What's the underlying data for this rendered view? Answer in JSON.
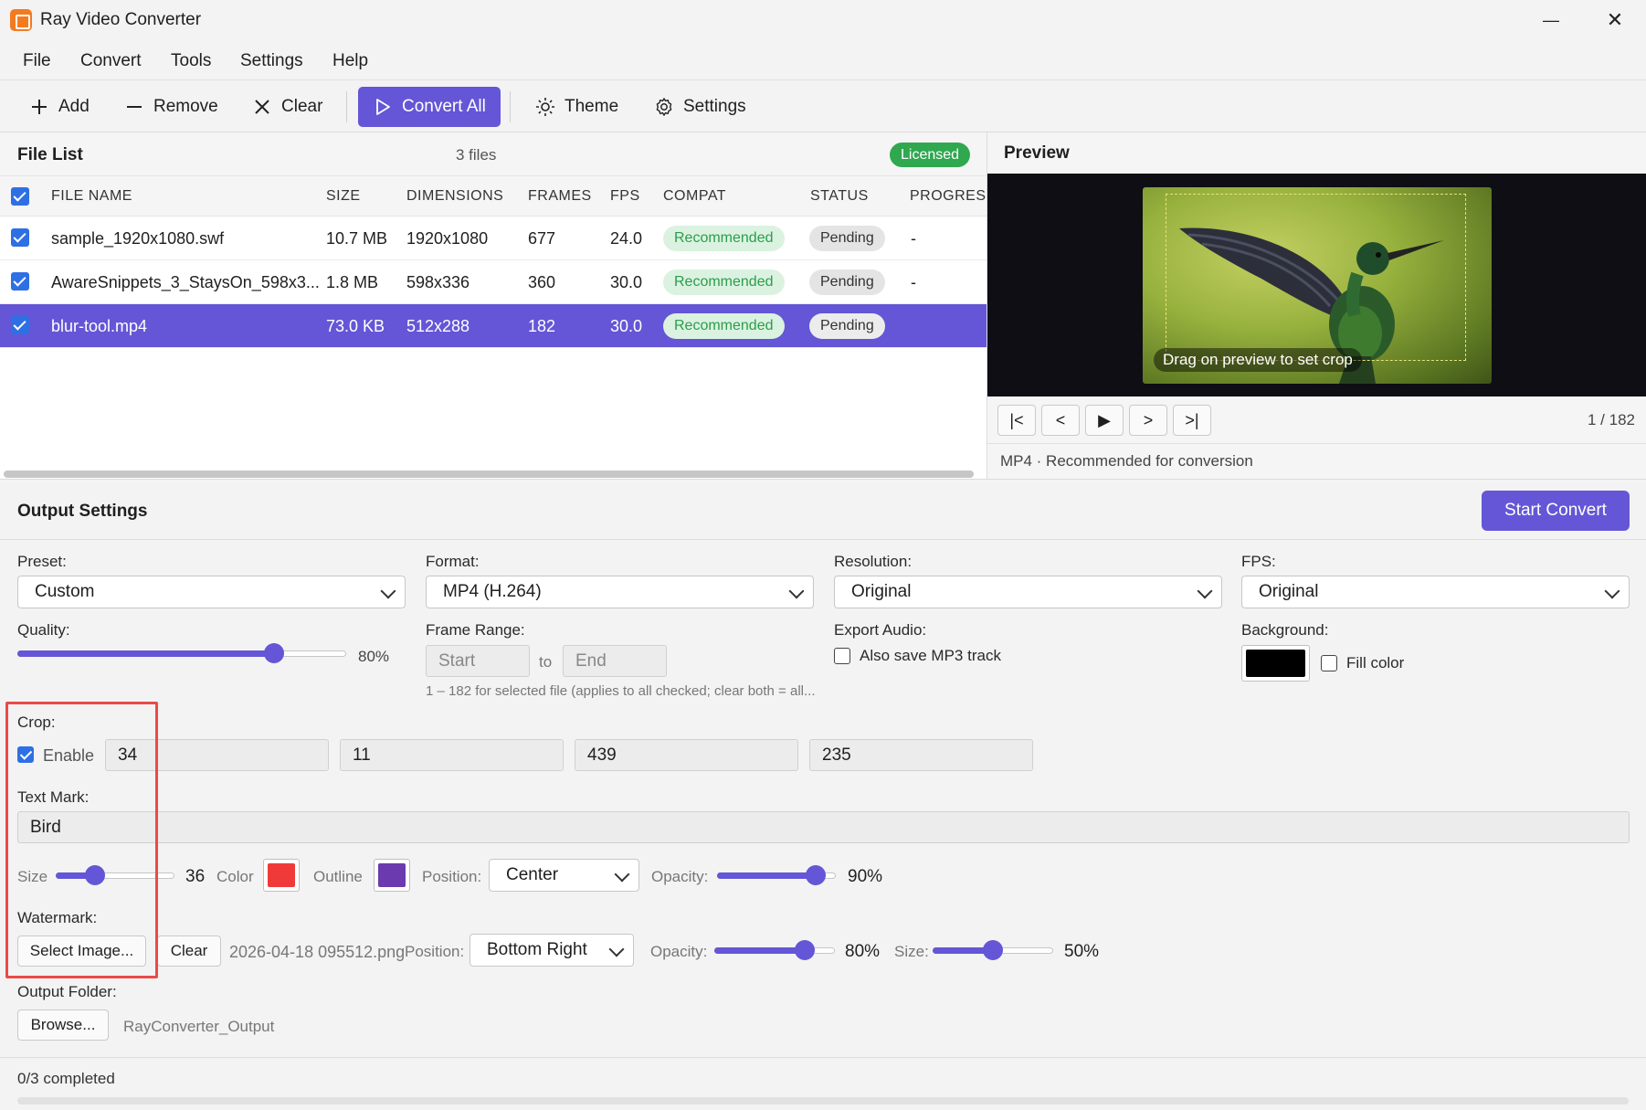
{
  "window": {
    "title": "Ray Video Converter",
    "minimize_glyph": "—",
    "maximize_glyph": "☐",
    "close_glyph": "✕"
  },
  "menu": [
    "File",
    "Convert",
    "Tools",
    "Settings",
    "Help"
  ],
  "toolbar": {
    "add": "Add",
    "remove": "Remove",
    "clear": "Clear",
    "convert_all": "Convert All",
    "theme": "Theme",
    "settings": "Settings"
  },
  "file_list": {
    "title": "File List",
    "count": "3 files",
    "license_badge": "Licensed",
    "columns": [
      "FILE NAME",
      "SIZE",
      "DIMENSIONS",
      "FRAMES",
      "FPS",
      "COMPAT",
      "STATUS",
      "PROGRESS"
    ],
    "rows": [
      {
        "name": "sample_1920x1080.swf",
        "size": "10.7 MB",
        "dimensions": "1920x1080",
        "frames": "677",
        "fps": "24.0",
        "compat": "Recommended",
        "status": "Pending",
        "progress": "-",
        "checked": true,
        "selected": false
      },
      {
        "name": "AwareSnippets_3_StaysOn_598x3...",
        "size": "1.8 MB",
        "dimensions": "598x336",
        "frames": "360",
        "fps": "30.0",
        "compat": "Recommended",
        "status": "Pending",
        "progress": "-",
        "checked": true,
        "selected": false
      },
      {
        "name": "blur-tool.mp4",
        "size": "73.0 KB",
        "dimensions": "512x288",
        "frames": "182",
        "fps": "30.0",
        "compat": "Recommended",
        "status": "Pending",
        "progress": "",
        "checked": true,
        "selected": true
      }
    ]
  },
  "preview": {
    "title": "Preview",
    "hint": "Drag on preview to set crop",
    "controls": [
      "|<",
      "<",
      "▶",
      ">",
      ">|"
    ],
    "frame_counter": "1 / 182",
    "info": "MP4 · Recommended for conversion"
  },
  "output": {
    "title": "Output Settings",
    "start_convert": "Start Convert",
    "preset": {
      "label": "Preset:",
      "value": "Custom"
    },
    "format": {
      "label": "Format:",
      "value": "MP4 (H.264)"
    },
    "resolution": {
      "label": "Resolution:",
      "value": "Original"
    },
    "fps": {
      "label": "FPS:",
      "value": "Original"
    },
    "quality": {
      "label": "Quality:",
      "value": 80,
      "display": "80%"
    },
    "frame_range": {
      "label": "Frame Range:",
      "start_placeholder": "Start",
      "to": "to",
      "end_placeholder": "End",
      "hint": "1 – 182 for selected file (applies to all checked; clear both = all..."
    },
    "export_audio": {
      "label": "Export Audio:",
      "checkbox": "Also save MP3 track",
      "checked": false
    },
    "background": {
      "label": "Background:",
      "color": "#000000",
      "fill_label": "Fill color",
      "fill_checked": false
    },
    "crop": {
      "label": "Crop:",
      "enable_label": "Enable",
      "enabled": true,
      "values": [
        "34",
        "11",
        "439",
        "235"
      ]
    },
    "text_mark": {
      "label": "Text Mark:",
      "value": "Bird",
      "size_label": "Size",
      "size": 36,
      "size_display": "36",
      "color_label": "Color",
      "color": "#f03a3a",
      "outline_label": "Outline",
      "outline_color": "#6a3aae",
      "position_label": "Position:",
      "position": "Center",
      "opacity_label": "Opacity:",
      "opacity": 90,
      "opacity_display": "90%"
    },
    "watermark": {
      "label": "Watermark:",
      "select_button": "Select Image...",
      "clear_button": "Clear",
      "file": "2026-04-18 095512.png",
      "position_label": "Position:",
      "position": "Bottom Right",
      "opacity_label": "Opacity:",
      "opacity": 80,
      "opacity_display": "80%",
      "size_label": "Size:",
      "size": 50,
      "size_display": "50%"
    },
    "output_folder": {
      "label": "Output Folder:",
      "browse_button": "Browse...",
      "path": "RayConverter_Output"
    }
  },
  "status": {
    "text": "0/3 completed",
    "progress": 0
  },
  "colors": {
    "accent": "#6456d6",
    "success": "#2fa84f",
    "highlight": "#ea4a4a"
  }
}
